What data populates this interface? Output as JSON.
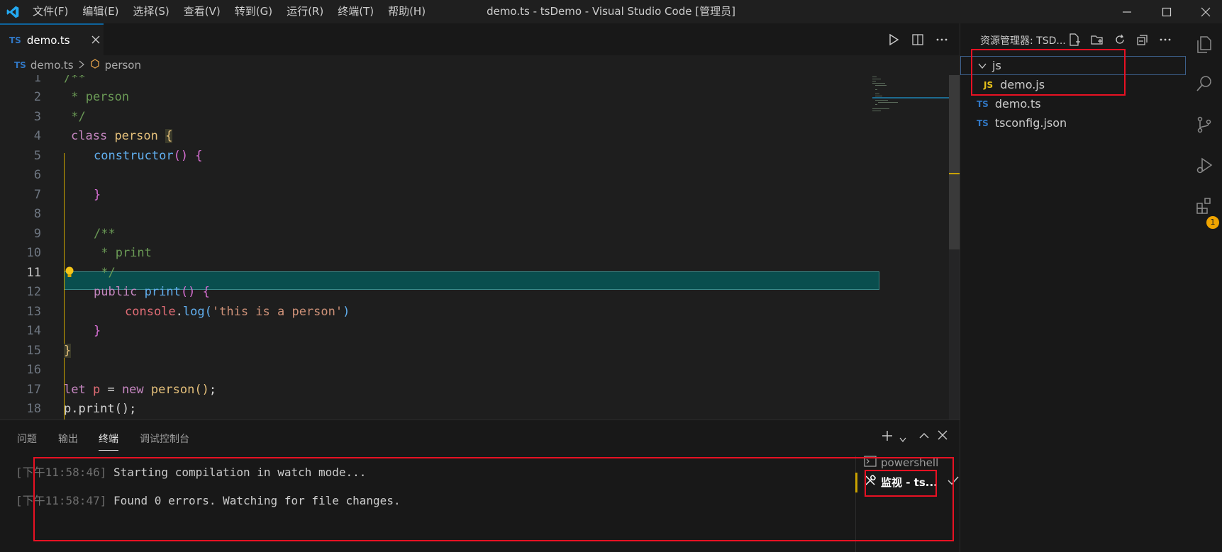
{
  "titlebar": {
    "menus": [
      "文件(F)",
      "编辑(E)",
      "选择(S)",
      "查看(V)",
      "转到(G)",
      "运行(R)",
      "终端(T)",
      "帮助(H)"
    ],
    "title": "demo.ts - tsDemo - Visual Studio Code [管理员]"
  },
  "tabs": [
    {
      "badge": "TS",
      "label": "demo.ts",
      "active": true
    }
  ],
  "breadcrumb": {
    "badge": "TS",
    "file": "demo.ts",
    "symbol": "person"
  },
  "editor": {
    "highlighted_line": 11,
    "lines": [
      {
        "n": "1"
      },
      {
        "n": "2"
      },
      {
        "n": "3"
      },
      {
        "n": "4"
      },
      {
        "n": "5"
      },
      {
        "n": "6"
      },
      {
        "n": "7"
      },
      {
        "n": "8"
      },
      {
        "n": "9"
      },
      {
        "n": "10"
      },
      {
        "n": "11"
      },
      {
        "n": "12"
      },
      {
        "n": "13"
      },
      {
        "n": "14"
      },
      {
        "n": "15"
      },
      {
        "n": "16"
      },
      {
        "n": "17"
      },
      {
        "n": "18"
      }
    ],
    "code": {
      "l1": "/**",
      "l2": " * person",
      "l3": " */",
      "l4_kw": "class",
      "l4_cls": "person",
      "l4_brace": "{",
      "l5_fn": "constructor",
      "l5_rest": "() {",
      "l7": "}",
      "l9": "/**",
      "l10": " * print",
      "l11": " */",
      "l12_kw": "public",
      "l12_fn": "print",
      "l12_rest": "() {",
      "l13_obj": "console",
      "l13_fn": "log",
      "l13_str": "'this is a person'",
      "l14": "}",
      "l15": "}",
      "l17_kw": "let",
      "l17_var": "p",
      "l17_new": "new",
      "l17_cls": "person",
      "l18": "p.print();"
    }
  },
  "panel": {
    "tabs": [
      "问题",
      "输出",
      "终端",
      "调试控制台"
    ],
    "active_tab": "终端",
    "terminal_lines": [
      {
        "time": "下午11:58:46",
        "text": "Starting compilation in watch mode..."
      },
      {
        "time": "下午11:58:47",
        "text": "Found 0 errors. Watching for file changes."
      }
    ],
    "terminal_list": [
      {
        "icon": "terminal-icon",
        "label": "powershell"
      },
      {
        "icon": "tools-icon",
        "label": "监视 - ts..."
      }
    ]
  },
  "explorer": {
    "title": "资源管理器: TSD...",
    "tree": [
      {
        "type": "folder",
        "label": "js",
        "expanded": true
      },
      {
        "type": "file",
        "badge": "JS",
        "label": "demo.js"
      },
      {
        "type": "file",
        "badge": "TS",
        "label": "demo.ts"
      },
      {
        "type": "file",
        "badge": "TS",
        "label": "tsconfig.json"
      }
    ]
  },
  "activitybar": {
    "extensions_badge": "1"
  },
  "colors": {
    "accent": "#0e639c",
    "highlight": "#094e4e",
    "annotation_box": "#e81123"
  }
}
